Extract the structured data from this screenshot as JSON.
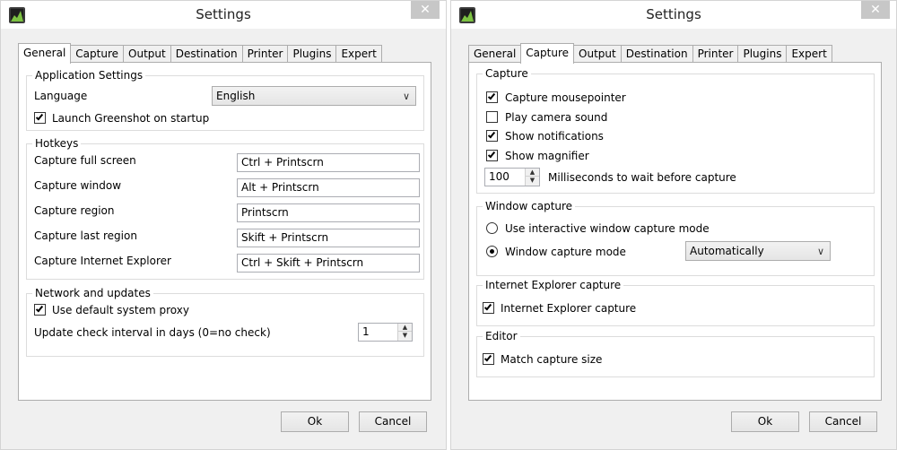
{
  "left_window": {
    "title": "Settings",
    "close_glyph": "✕",
    "tabs": [
      "General",
      "Capture",
      "Output",
      "Destination",
      "Printer",
      "Plugins",
      "Expert"
    ],
    "active_tab": "General",
    "app_settings": {
      "title": "Application Settings",
      "language_label": "Language",
      "language_value": "English",
      "launch_label": "Launch Greenshot on startup",
      "launch_checked": true
    },
    "hotkeys": {
      "title": "Hotkeys",
      "items": [
        {
          "label": "Capture full screen",
          "value": "Ctrl + Printscrn"
        },
        {
          "label": "Capture window",
          "value": "Alt + Printscrn"
        },
        {
          "label": "Capture region",
          "value": "Printscrn"
        },
        {
          "label": "Capture last region",
          "value": "Skift + Printscrn"
        },
        {
          "label": "Capture Internet Explorer",
          "value": "Ctrl + Skift + Printscrn"
        }
      ]
    },
    "network": {
      "title": "Network and updates",
      "proxy_label": "Use default system proxy",
      "proxy_checked": true,
      "interval_label": "Update check interval in days (0=no check)",
      "interval_value": "1"
    },
    "ok_label": "Ok",
    "cancel_label": "Cancel"
  },
  "right_window": {
    "title": "Settings",
    "close_glyph": "✕",
    "tabs": [
      "General",
      "Capture",
      "Output",
      "Destination",
      "Printer",
      "Plugins",
      "Expert"
    ],
    "active_tab": "Capture",
    "capture": {
      "title": "Capture",
      "mousepointer_label": "Capture mousepointer",
      "mousepointer_checked": true,
      "camera_label": "Play camera sound",
      "camera_checked": false,
      "notifications_label": "Show notifications",
      "notifications_checked": true,
      "magnifier_label": "Show magnifier",
      "magnifier_checked": true,
      "wait_value": "100",
      "wait_label": "Milliseconds to wait before capture"
    },
    "window_capture": {
      "title": "Window capture",
      "interactive_label": "Use interactive window capture mode",
      "interactive_selected": false,
      "mode_label": "Window capture mode",
      "mode_selected": true,
      "mode_value": "Automatically"
    },
    "ie_capture": {
      "title": "Internet Explorer capture",
      "checkbox_label": "Internet Explorer capture",
      "checked": true
    },
    "editor": {
      "title": "Editor",
      "match_label": "Match capture size",
      "checked": true
    },
    "ok_label": "Ok",
    "cancel_label": "Cancel"
  },
  "colors": {
    "panel_bg": "#ffffff",
    "window_bg": "#f0f0f0",
    "close_button_bg": "#c7c7c7",
    "icon_bg": "#1e1e1e",
    "icon_accent": "#7cc242"
  }
}
